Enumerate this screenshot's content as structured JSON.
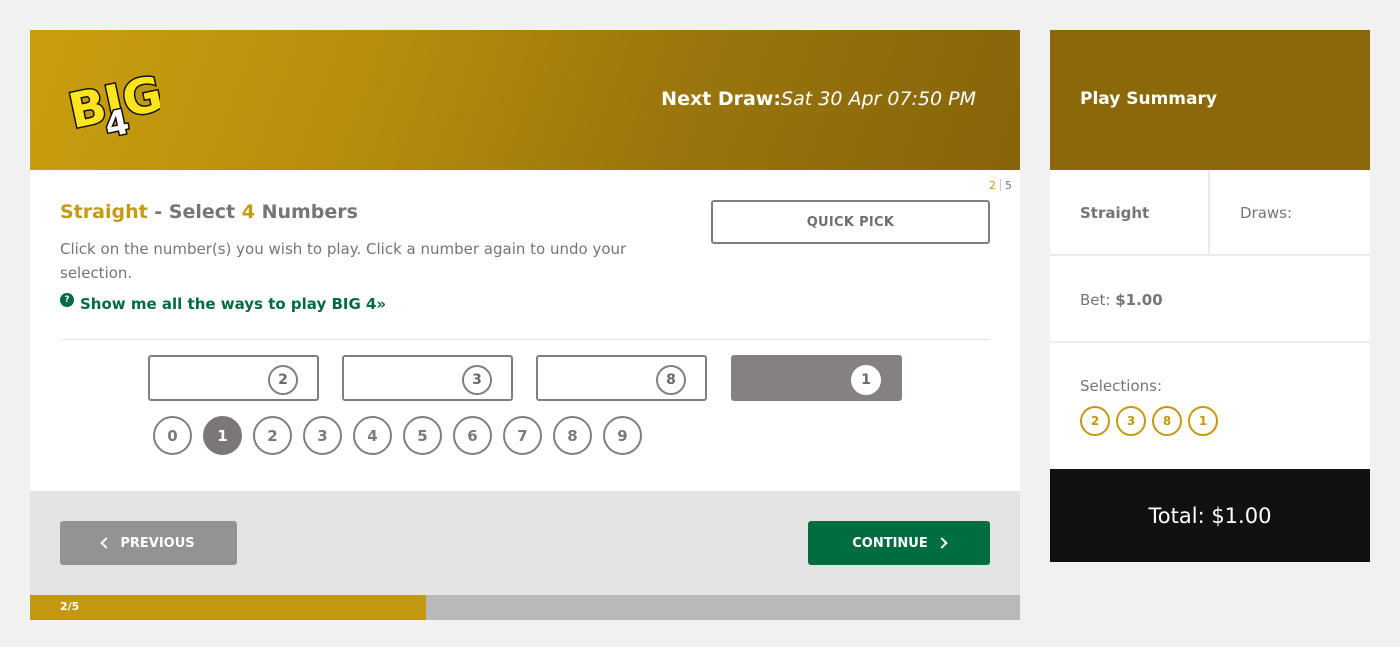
{
  "header": {
    "logo_text": "BIG 4",
    "next_draw_label": "Next Draw:",
    "next_draw_value": "Sat 30 Apr 07:50 PM",
    "step_current": "2",
    "step_total": "5"
  },
  "play": {
    "title_type": "Straight",
    "title_sep": " - Select ",
    "title_count": "4",
    "title_suffix": " Numbers",
    "description": "Click on the number(s) you wish to play. Click a number again to undo your selection.",
    "help_icon": "?",
    "help_link": "Show me all the ways to play BIG 4»",
    "quick_pick_label": "QUICK PICK",
    "slots": [
      "2",
      "3",
      "8",
      "1"
    ],
    "active_slot": 3,
    "digits": [
      "0",
      "1",
      "2",
      "3",
      "4",
      "5",
      "6",
      "7",
      "8",
      "9"
    ],
    "selected_digit": "1"
  },
  "footer": {
    "previous_label": "PREVIOUS",
    "continue_label": "CONTINUE",
    "progress_text": "2/5",
    "progress_fraction": 0.4
  },
  "summary": {
    "title": "Play Summary",
    "play_type": "Straight",
    "draws_label": "Draws:",
    "bet_label": "Bet: ",
    "bet_value": "$1.00",
    "selections_label": "Selections:",
    "selections": [
      "2",
      "3",
      "8",
      "1"
    ],
    "total": "Total: $1.00"
  },
  "colors": {
    "gold": "#c59a17",
    "green": "#006d3f",
    "header_dark": "#8b690a"
  }
}
